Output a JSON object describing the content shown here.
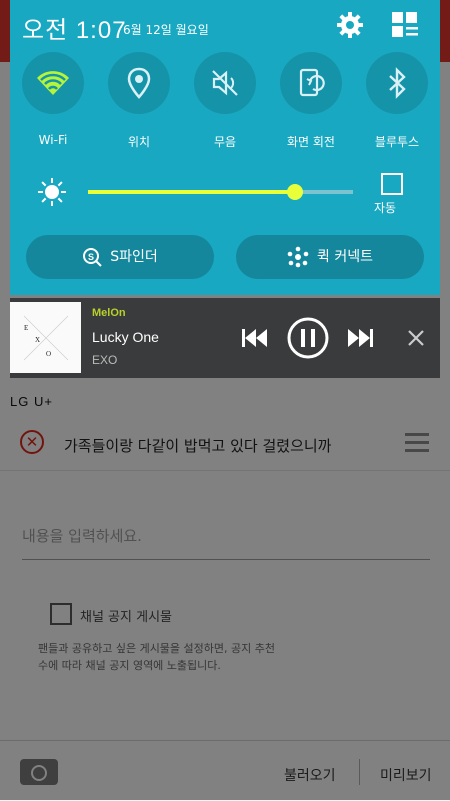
{
  "status": {
    "time": "오전 1:07",
    "date": "6월 12일 월요일"
  },
  "quick_toggles": [
    {
      "label": "Wi-Fi",
      "icon": "wifi-icon",
      "active": true
    },
    {
      "label": "위치",
      "icon": "location-icon",
      "active": false
    },
    {
      "label": "무음",
      "icon": "mute-icon",
      "active": false
    },
    {
      "label": "화면 회전",
      "icon": "rotate-icon",
      "active": false
    },
    {
      "label": "블루투스",
      "icon": "bluetooth-icon",
      "active": false
    }
  ],
  "brightness": {
    "level": 0.78,
    "auto_label": "자동"
  },
  "shortcuts": {
    "s_finder": "S파인더",
    "quick_connect": "퀵 커넥트"
  },
  "music": {
    "app": "MelOn",
    "song": "Lucky One",
    "artist": "EXO",
    "album_letters": [
      "E",
      "X",
      "O"
    ]
  },
  "background_app": {
    "carrier": "LG U+",
    "notice_title": "가족들이랑 다같이 밥먹고 있다 걸렸으니까",
    "input_placeholder": "내용을 입력하세요.",
    "checkbox_label": "채널 공지 게시물",
    "checkbox_desc": "팬들과 공유하고 싶은 게시물을 설정하면, 공지 추천수에 따라 채널 공지 영역에 노출됩니다.",
    "load_button": "불러오기",
    "preview_button": "미리보기"
  },
  "colors": {
    "shade": "#19a8c1",
    "toggle_bg": "#1593a9",
    "wifi_active": "#b4f43a",
    "slider": "#e8ff3a",
    "music_bg": "#3a3b3c",
    "app_red": "#d9352c"
  }
}
